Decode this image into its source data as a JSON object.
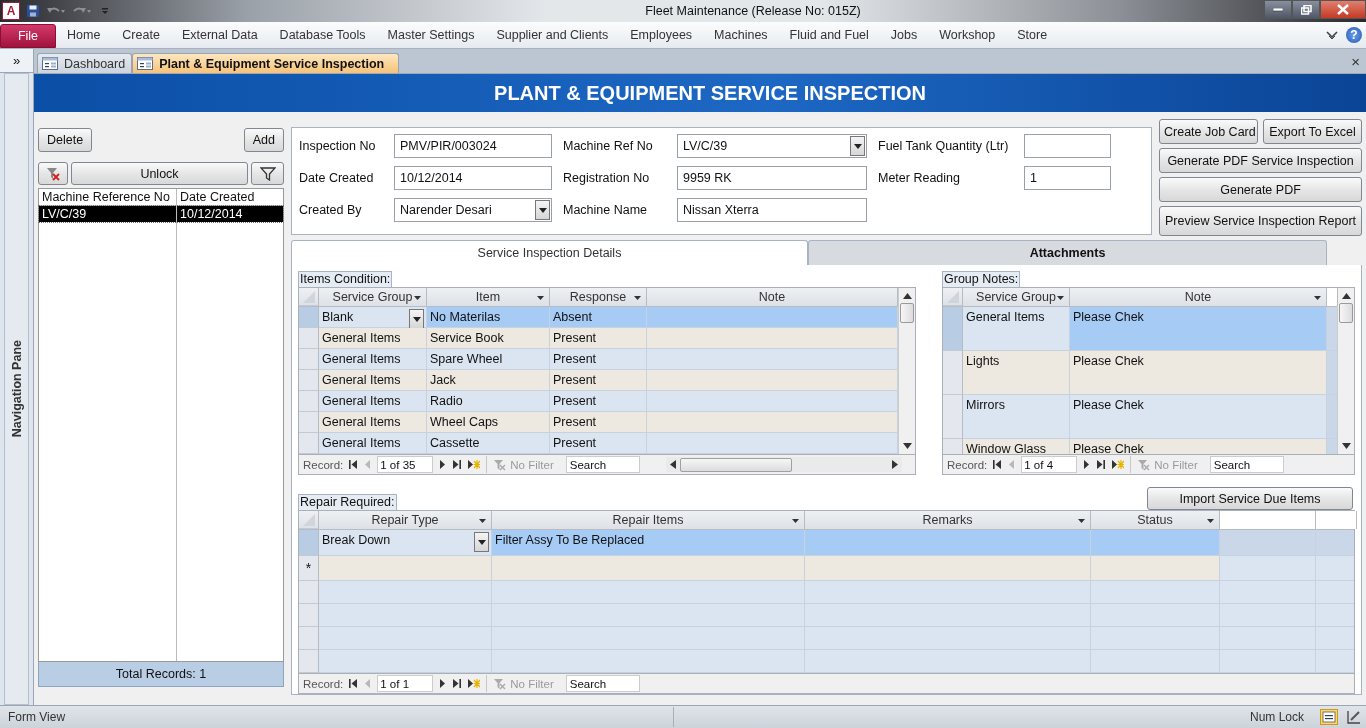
{
  "window": {
    "app_icon": "A",
    "title": "Fleet Maintenance (Release No: 015Z)"
  },
  "ribbon": {
    "file": "File",
    "tabs": [
      "Home",
      "Create",
      "External Data",
      "Database Tools",
      "Master Settings",
      "Supplier and Clients",
      "Employees",
      "Machines",
      "Fluid and Fuel",
      "Jobs",
      "Workshop",
      "Store"
    ],
    "help": "?"
  },
  "nav_pane": {
    "toggle": "»",
    "label": "Navigation Pane"
  },
  "doc_tabs": [
    {
      "label": "Dashboard",
      "selected": false
    },
    {
      "label": "Plant & Equipment Service Inspection",
      "selected": true
    }
  ],
  "doc_close": "×",
  "form_title": "PLANT & EQUIPMENT SERVICE INSPECTION",
  "record_list": {
    "delete": "Delete",
    "add": "Add",
    "unlock": "Unlock",
    "columns": [
      "Machine Reference No",
      "Date Created"
    ],
    "rows": [
      {
        "cells": [
          "LV/C/39",
          "10/12/2014"
        ],
        "selected": true
      }
    ],
    "total": "Total Records: 1"
  },
  "fields": [
    [
      {
        "label": "Inspection No",
        "value": "PMV/PIR/003024",
        "kind": "text"
      },
      {
        "label": "Date Created",
        "value": "10/12/2014",
        "kind": "text"
      },
      {
        "label": "Created By",
        "value": "Narender Desari",
        "kind": "combo"
      }
    ],
    [
      {
        "label": "Machine Ref No",
        "value": "LV/C/39",
        "kind": "combo"
      },
      {
        "label": "Registration No",
        "value": "9959 RK",
        "kind": "text"
      },
      {
        "label": "Machine Name",
        "value": "Nissan Xterra",
        "kind": "text"
      }
    ],
    [
      {
        "label": "Fuel Tank Quantity (Ltr)",
        "kind": "text"
      },
      {
        "label": "Meter Reading",
        "value": "1",
        "kind": "text"
      }
    ]
  ],
  "actions": [
    {
      "label": "Create Job Card",
      "kind": "half"
    },
    {
      "label": "Export To Excel",
      "kind": "half"
    },
    {
      "label": "Generate PDF Service Inspection",
      "kind": "full"
    },
    {
      "label": "Generate PDF",
      "kind": "full"
    },
    {
      "label": "Preview Service Inspection Report",
      "kind": "full"
    }
  ],
  "subtabs": [
    {
      "label": "Service Inspection Details",
      "selected": true
    },
    {
      "label": "Attachments",
      "selected": false
    }
  ],
  "subforms": [
    {
      "kind": "items",
      "caption": "Items Condition:",
      "columns": [
        {
          "label": "Service Group",
          "arrow": true,
          "combo": true
        },
        {
          "label": "Item",
          "arrow": true,
          "combo": false
        },
        {
          "label": "Response",
          "arrow": true,
          "combo": false
        },
        {
          "label": "Note",
          "arrow": false,
          "combo": false
        }
      ],
      "rows": [
        {
          "cells": [
            "Blank",
            "No Materilas",
            "Absent",
            ""
          ],
          "selected": true
        },
        {
          "cells": [
            "General Items",
            "Service Book",
            "Present",
            ""
          ],
          "selected": false
        },
        {
          "cells": [
            "General Items",
            "Spare Wheel",
            "Present",
            ""
          ],
          "selected": false
        },
        {
          "cells": [
            "General Items",
            "Jack",
            "Present",
            ""
          ],
          "selected": false
        },
        {
          "cells": [
            "General Items",
            "Radio",
            "Present",
            ""
          ],
          "selected": false
        },
        {
          "cells": [
            "General Items",
            "Wheel Caps",
            "Present",
            ""
          ],
          "selected": false
        },
        {
          "cells": [
            "General Items",
            "Cassette",
            "Present",
            ""
          ],
          "selected": false
        }
      ],
      "nav": {
        "label": "Record:",
        "position": "1 of 35",
        "filter": "No Filter",
        "search_placeholder": "Search"
      }
    },
    {
      "kind": "notes",
      "caption": "Group Notes:",
      "columns": [
        {
          "label": "Service Group",
          "arrow": true,
          "combo": false
        },
        {
          "label": "Note",
          "arrow": true,
          "combo": false
        }
      ],
      "rows": [
        {
          "cells": [
            "General Items",
            "Please Chek"
          ],
          "selected": true
        },
        {
          "cells": [
            "Lights",
            "Please Chek"
          ],
          "selected": false
        },
        {
          "cells": [
            "Mirrors",
            "Please Chek"
          ],
          "selected": false
        },
        {
          "cells": [
            "Window Glass",
            "Please Chek"
          ],
          "selected": false
        }
      ],
      "nav": {
        "label": "Record:",
        "position": "1 of 4",
        "filter": "No Filter",
        "search_placeholder": "Search"
      }
    },
    {
      "kind": "repair",
      "caption": "Repair Required:",
      "button": "Import Service Due Items",
      "columns": [
        {
          "label": "Repair Type",
          "arrow": true,
          "combo": true
        },
        {
          "label": "Repair Items",
          "arrow": true,
          "combo": false
        },
        {
          "label": "Remarks",
          "arrow": true,
          "combo": false
        },
        {
          "label": "Status",
          "arrow": true,
          "combo": false
        }
      ],
      "rows": [
        {
          "cells": [
            "Break Down",
            "Filter Assy To Be Replaced",
            "",
            ""
          ],
          "selected": true
        }
      ],
      "new_row_marker": "*",
      "nav": {
        "label": "Record:",
        "position": "1 of 1",
        "filter": "No Filter",
        "search_placeholder": "Search"
      }
    }
  ],
  "status_bar": {
    "left": "Form View",
    "right": "Num Lock"
  }
}
